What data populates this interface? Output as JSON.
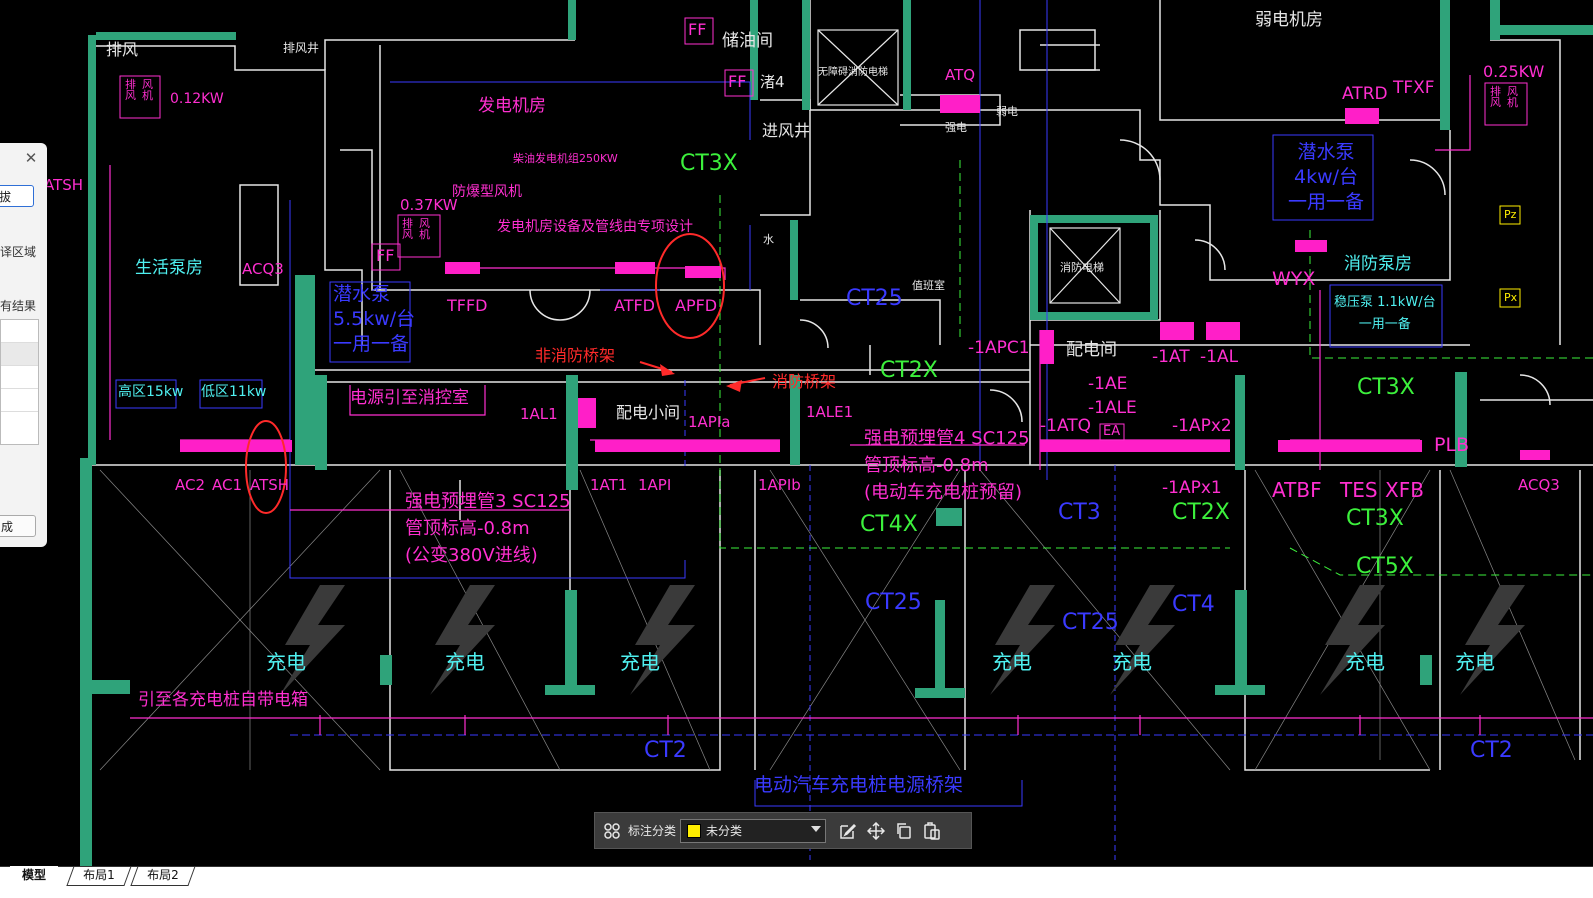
{
  "drawing": {
    "rooms": {
      "exhaust_left": "排风",
      "exhaust_shaft": "排风井",
      "fan_left": [
        "排",
        "风",
        "风",
        "机"
      ],
      "fan_left_power": "0.12KW",
      "gen_room": "发电机房",
      "gen_set": "柴油发电机组250KW",
      "fan_mid_power": "0.37KW",
      "fan_mid": [
        "排",
        "风",
        "风",
        "机"
      ],
      "explosion_fan": "防爆型风机",
      "gen_note": "发电机房设备及管线由专项设计",
      "oil_room": "储油间",
      "ff1": "FF",
      "ff2": "FF",
      "ff3": "FF",
      "num4": "渚4",
      "elevator_left": "无障碍消防电梯",
      "intake_shaft": "进风井",
      "water": "水",
      "atq": "ATQ",
      "strong_elec": "强电",
      "weak_elec": "弱电",
      "weak_room": "弱电机房",
      "pump_room": "生活泵房",
      "acq3": "ACQ3",
      "atsh_left": "ATSH",
      "tffd": "TFFD",
      "atfd": "ATFD",
      "apfd": "APFD",
      "pump_left": [
        "潜水泵",
        "5.5kw/台",
        "一用一备"
      ],
      "high_zone": "高区15kw",
      "low_zone": "低区11kw",
      "power_to_control": "电源引至消控室",
      "non_fire_tray": "非消防桥架",
      "fire_tray": "消防桥架",
      "al1": "1AL1",
      "dist_small": "配电小间",
      "api_a": "1APIa",
      "ale1": "1ALE1",
      "ac2": "AC2",
      "ac1": "AC1",
      "atsh": "ATSH",
      "at1": "1AT1",
      "api": "1API",
      "api_b": "1APIb",
      "duct3": [
        "强电预埋管3 SC125",
        "管顶标高-0.8m",
        "(公变380V进线)"
      ],
      "duct4": [
        "强电预埋管4 SC125",
        "管顶标高-0.8m",
        "(电动车充电桩预留)"
      ],
      "ct3x_a": "CT3X",
      "ct25_a": "CT25",
      "duty_room": "值班室",
      "ct2x_a": "CT2X",
      "apc1": "-1APC1",
      "dist_room": "配电间",
      "at_m1": "-1AT",
      "al_m1": "-1AL",
      "ae_m1": "-1AE",
      "ale_m1": "-1ALE",
      "atq_m1": "-1ATQ",
      "ea": "EA",
      "apx2": "-1APx2",
      "apx1": "-1APx1",
      "ct3": "CT3",
      "ct2x_b": "CT2X",
      "ct4x": "CT4X",
      "elevator_right": "消防电梯",
      "atrd": "ATRD",
      "tfxf": "TFXF",
      "fan_right_power": "0.25KW",
      "fan_right": [
        "排",
        "风",
        "风",
        "机"
      ],
      "pump_right": [
        "潜水泵",
        "4kw/台",
        "一用一备"
      ],
      "wyx": "WYX",
      "fire_pump": "消防泵房",
      "stabilizer": [
        "稳压泵 1.1kW/台",
        "一用一备"
      ],
      "pz": "Pz",
      "px": "Px",
      "ct3x_b": "CT3X",
      "plb": "PLB",
      "atbf": "ATBF",
      "tes": "TES",
      "xfb": "XFB",
      "ct3x_c": "CT3X",
      "acq3_r": "ACQ3",
      "ct5x": "CT5X",
      "ct25_b": "CT25",
      "ct25_c": "CT25",
      "ct4": "CT4",
      "charging": "充电",
      "to_chargers": "引至各充电桩自带电箱",
      "ct2_a": "CT2",
      "ct2_b": "CT2",
      "ev_tray": "电动汽车充电桩电源桥架"
    }
  },
  "side_dialog": {
    "input_value": "拔",
    "area_text": "译区域",
    "result_text": "有结果",
    "button_text": "成"
  },
  "toolbar": {
    "label": "标注分类",
    "select_value": "未分类",
    "swatch_color": "#ffee00",
    "icons": [
      "grid-icon",
      "edit-icon",
      "move-icon",
      "copy-icon",
      "paste-icon"
    ]
  },
  "tabs": [
    "模型",
    "布局1",
    "布局2"
  ],
  "colors": {
    "wall": "#2fa37a",
    "pink": "#ff2fd0",
    "cyan": "#4ff0f0",
    "green": "#3cf03c",
    "blue": "#3a3aff",
    "red": "#ff2a2a"
  }
}
